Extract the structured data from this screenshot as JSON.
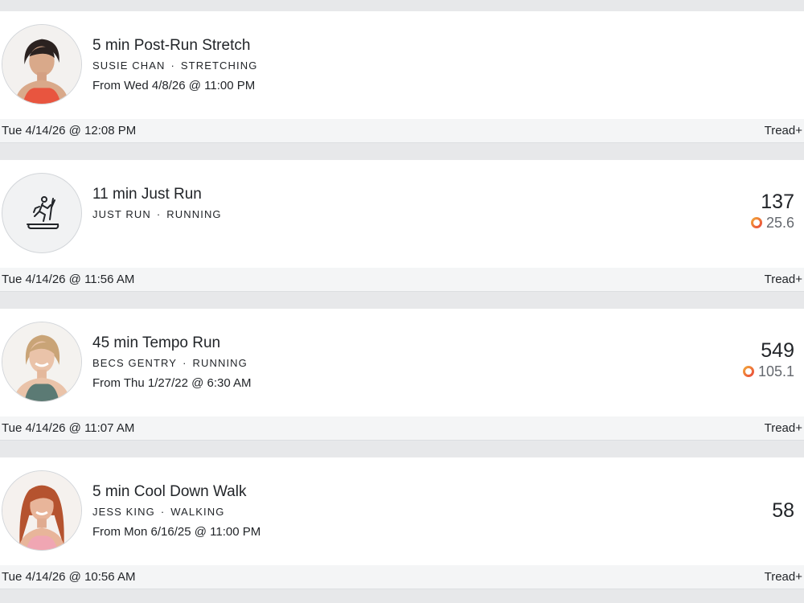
{
  "colors": {
    "page_background": "#e7e8ea",
    "card_background": "#ffffff",
    "footer_background": "#f4f5f6",
    "text_primary": "#222529",
    "text_secondary": "#65696f",
    "ring_gradient_start": "#f2a33a",
    "ring_gradient_end": "#ea4d3a"
  },
  "workouts": [
    {
      "avatar_type": "photo",
      "avatar_icon": "instructor-photo",
      "title": "5 min Post-Run Stretch",
      "instructor": "SUSIE CHAN",
      "separator": "·",
      "category": "STRETCHING",
      "from": "From Wed 4/8/26 @ 11:00 PM",
      "output": "",
      "strive_score": "",
      "date": "Tue 4/14/26 @ 12:08 PM",
      "device": "Tread+"
    },
    {
      "avatar_type": "icon",
      "avatar_icon": "treadmill-runner-icon",
      "title": "11 min Just Run",
      "instructor": "JUST RUN",
      "separator": "·",
      "category": "RUNNING",
      "from": "",
      "output": "137",
      "strive_score": "25.6",
      "strive_icon": "strive-ring-icon",
      "date": "Tue 4/14/26 @ 11:56 AM",
      "device": "Tread+"
    },
    {
      "avatar_type": "photo",
      "avatar_icon": "instructor-photo",
      "title": "45 min Tempo Run",
      "instructor": "BECS GENTRY",
      "separator": "·",
      "category": "RUNNING",
      "from": "From Thu 1/27/22 @ 6:30 AM",
      "output": "549",
      "strive_score": "105.1",
      "strive_icon": "strive-ring-icon",
      "date": "Tue 4/14/26 @ 11:07 AM",
      "device": "Tread+"
    },
    {
      "avatar_type": "photo",
      "avatar_icon": "instructor-photo",
      "title": "5 min Cool Down Walk",
      "instructor": "JESS KING",
      "separator": "·",
      "category": "WALKING",
      "from": "From Mon 6/16/25 @ 11:00 PM",
      "output": "58",
      "strive_score": "",
      "date": "Tue 4/14/26 @ 10:56 AM",
      "device": "Tread+"
    }
  ]
}
